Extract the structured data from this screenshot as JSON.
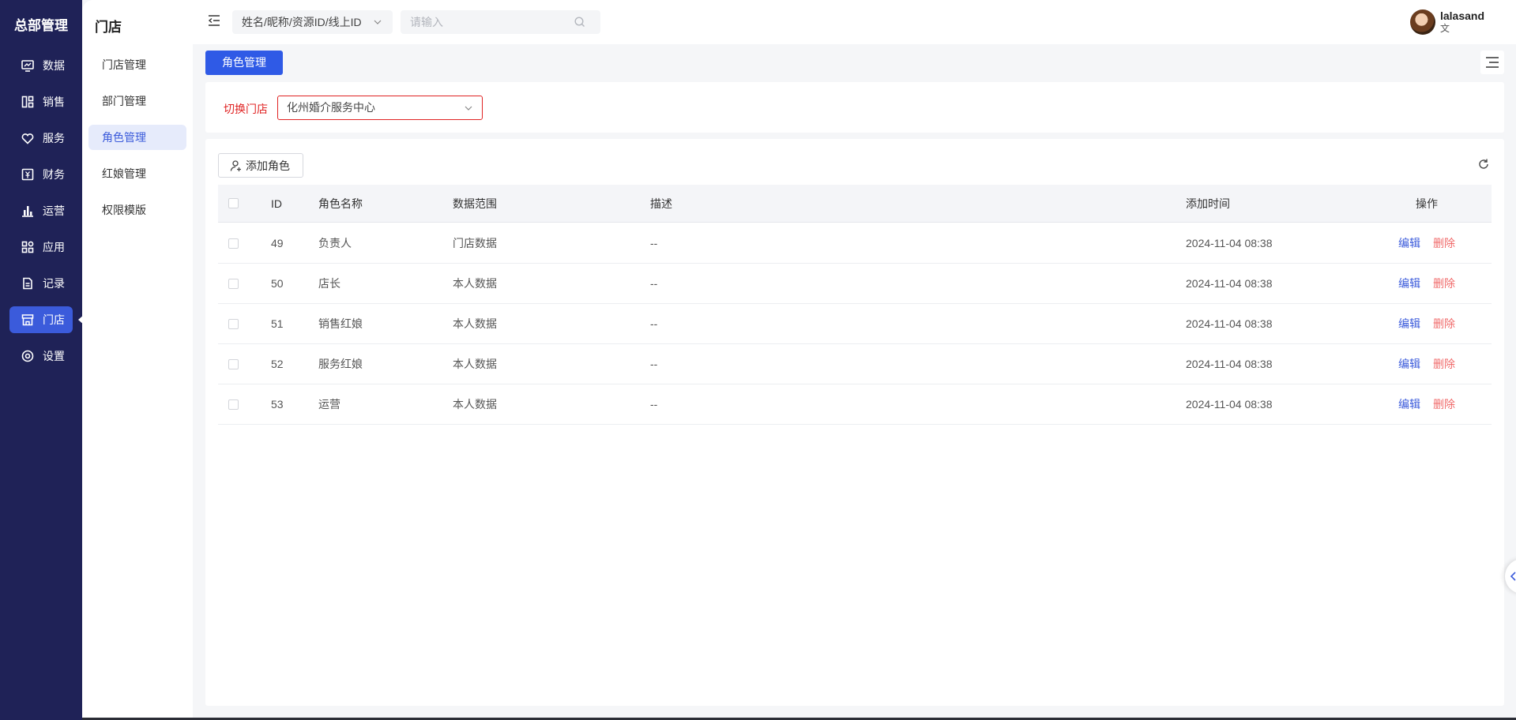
{
  "rail": {
    "title": "总部管理",
    "items": [
      {
        "label": "数据",
        "icon": "chart-monitor-icon"
      },
      {
        "label": "销售",
        "icon": "layout-grid-icon"
      },
      {
        "label": "服务",
        "icon": "heart-icon"
      },
      {
        "label": "财务",
        "icon": "yen-icon"
      },
      {
        "label": "运营",
        "icon": "bar-chart-icon"
      },
      {
        "label": "应用",
        "icon": "apps-icon"
      },
      {
        "label": "记录",
        "icon": "document-icon"
      },
      {
        "label": "门店",
        "icon": "store-icon"
      },
      {
        "label": "设置",
        "icon": "settings-icon"
      }
    ],
    "active": "门店"
  },
  "subnav": {
    "title": "门店",
    "items": [
      {
        "label": "门店管理"
      },
      {
        "label": "部门管理"
      },
      {
        "label": "角色管理"
      },
      {
        "label": "红娘管理"
      },
      {
        "label": "权限模版"
      }
    ],
    "active": "角色管理"
  },
  "topbar": {
    "search_type": "姓名/昵称/资源ID/线上ID",
    "search_placeholder": "请输入",
    "user_name": "lalasand",
    "user_sub": "文"
  },
  "tabs": {
    "active_label": "角色管理"
  },
  "filter": {
    "label": "切换门店",
    "store_value": "化州婚介服务中心"
  },
  "table": {
    "add_button": "添加角色",
    "columns": {
      "id": "ID",
      "name": "角色名称",
      "scope": "数据范围",
      "desc": "描述",
      "time": "添加时间",
      "ops": "操作"
    },
    "rows": [
      {
        "id": "49",
        "name": "负责人",
        "scope": "门店数据",
        "desc": "--",
        "time": "2024-11-04 08:38",
        "edit": "编辑",
        "delete": "删除"
      },
      {
        "id": "50",
        "name": "店长",
        "scope": "本人数据",
        "desc": "--",
        "time": "2024-11-04 08:38",
        "edit": "编辑",
        "delete": "删除"
      },
      {
        "id": "51",
        "name": "销售红娘",
        "scope": "本人数据",
        "desc": "--",
        "time": "2024-11-04 08:38",
        "edit": "编辑",
        "delete": "删除"
      },
      {
        "id": "52",
        "name": "服务红娘",
        "scope": "本人数据",
        "desc": "--",
        "time": "2024-11-04 08:38",
        "edit": "编辑",
        "delete": "删除"
      },
      {
        "id": "53",
        "name": "运营",
        "scope": "本人数据",
        "desc": "--",
        "time": "2024-11-04 08:38",
        "edit": "编辑",
        "delete": "删除"
      }
    ]
  },
  "colors": {
    "rail_bg": "#1f2257",
    "accent": "#3b5bdb",
    "primary_button": "#2f5ae6",
    "danger": "#e02424",
    "delete_link": "#f06a6a"
  }
}
